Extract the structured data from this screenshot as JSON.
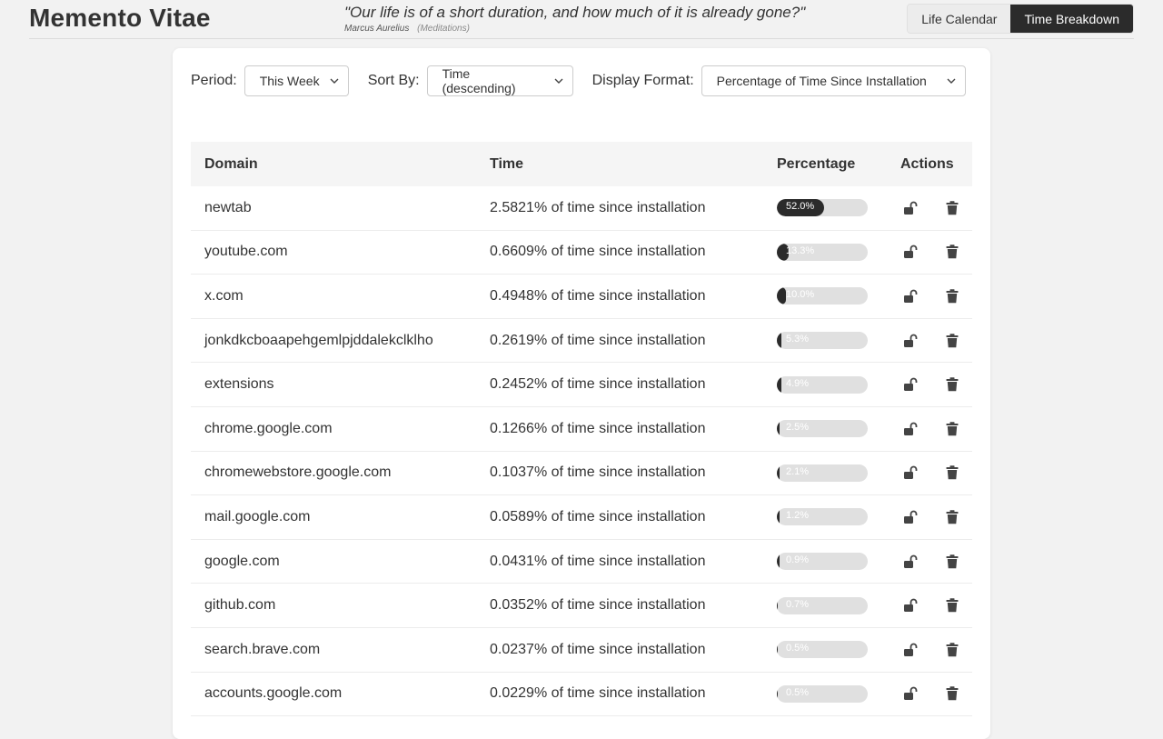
{
  "header": {
    "title": "Memento Vitae",
    "quote": "\"Our life is of a short duration, and how much of it is already gone?\"",
    "author": "Marcus Aurelius",
    "work": "(Meditations)",
    "tabs": [
      "Life Calendar",
      "Time Breakdown"
    ],
    "active_tab": "Time Breakdown"
  },
  "controls": {
    "period_label": "Period:",
    "period_value": "This Week",
    "sort_label": "Sort By:",
    "sort_value": "Time (descending)",
    "format_label": "Display Format:",
    "format_value": "Percentage of Time Since Installation"
  },
  "table": {
    "headers": [
      "Domain",
      "Time",
      "Percentage",
      "Actions"
    ],
    "rows": [
      {
        "domain": "newtab",
        "time": "2.5821% of time since installation",
        "pct": "52.0%",
        "fill": 0.52
      },
      {
        "domain": "youtube.com",
        "time": "0.6609% of time since installation",
        "pct": "13.3%",
        "fill": 0.133
      },
      {
        "domain": "x.com",
        "time": "0.4948% of time since installation",
        "pct": "10.0%",
        "fill": 0.1
      },
      {
        "domain": "jonkdkcboaapehgemlpjddalekclklho",
        "time": "0.2619% of time since installation",
        "pct": "5.3%",
        "fill": 0.053
      },
      {
        "domain": "extensions",
        "time": "0.2452% of time since installation",
        "pct": "4.9%",
        "fill": 0.049
      },
      {
        "domain": "chrome.google.com",
        "time": "0.1266% of time since installation",
        "pct": "2.5%",
        "fill": 0.025
      },
      {
        "domain": "chromewebstore.google.com",
        "time": "0.1037% of time since installation",
        "pct": "2.1%",
        "fill": 0.021
      },
      {
        "domain": "mail.google.com",
        "time": "0.0589% of time since installation",
        "pct": "1.2%",
        "fill": 0.012
      },
      {
        "domain": "google.com",
        "time": "0.0431% of time since installation",
        "pct": "0.9%",
        "fill": 0.009
      },
      {
        "domain": "github.com",
        "time": "0.0352% of time since installation",
        "pct": "0.7%",
        "fill": 0.007
      },
      {
        "domain": "search.brave.com",
        "time": "0.0237% of time since installation",
        "pct": "0.5%",
        "fill": 0.005
      },
      {
        "domain": "accounts.google.com",
        "time": "0.0229% of time since installation",
        "pct": "0.5%",
        "fill": 0.005
      }
    ],
    "row_actions": [
      "unlock-icon",
      "trash-icon"
    ]
  },
  "colors": {
    "accent": "#2b2b2b",
    "bar_track": "#e0e0e0",
    "background": "#f2f2f2"
  }
}
